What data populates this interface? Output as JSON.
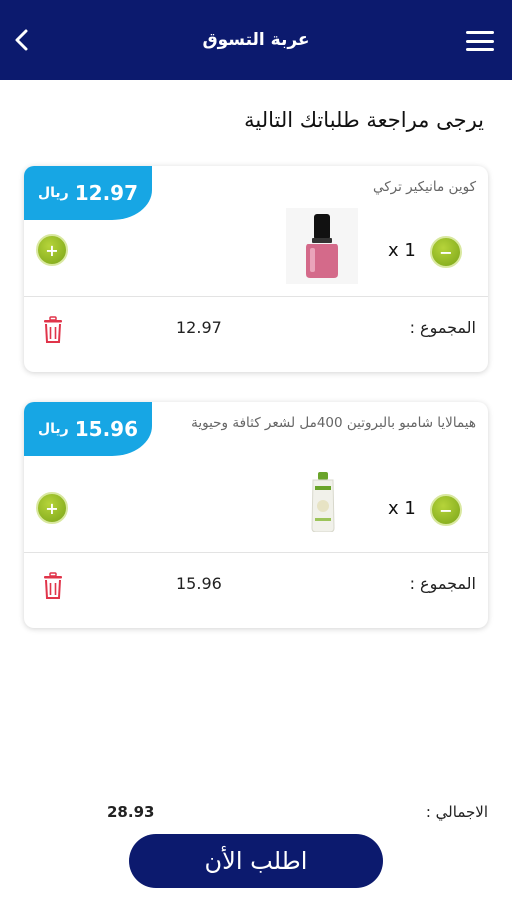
{
  "header": {
    "title": "عربة التسوق",
    "back_icon": "chevron-left-icon",
    "menu_icon": "hamburger-menu-icon"
  },
  "subtitle": "يرجى مراجعة طلباتك التالية",
  "items": [
    {
      "price_amount": "12.97",
      "currency": "ريال",
      "name": "كوين مانيكير تركي",
      "quantity": "x 1",
      "total_label": "المجموع :",
      "total_value": "12.97"
    },
    {
      "price_amount": "15.96",
      "currency": "ريال",
      "name": "هيمالايا شامبو بالبروتين 400مل لشعر كثافة وحيوية",
      "quantity": "x 1",
      "total_label": "المجموع :",
      "total_value": "15.96"
    }
  ],
  "summary": {
    "grand_total_label": "الاجمالي :",
    "grand_total_value": "28.93"
  },
  "order_button": "اطلب الأن",
  "colors": {
    "header_bg": "#0c1a6e",
    "price_badge": "#17a6e4",
    "qty_button": "#8cb521",
    "trash": "#e0344a"
  }
}
